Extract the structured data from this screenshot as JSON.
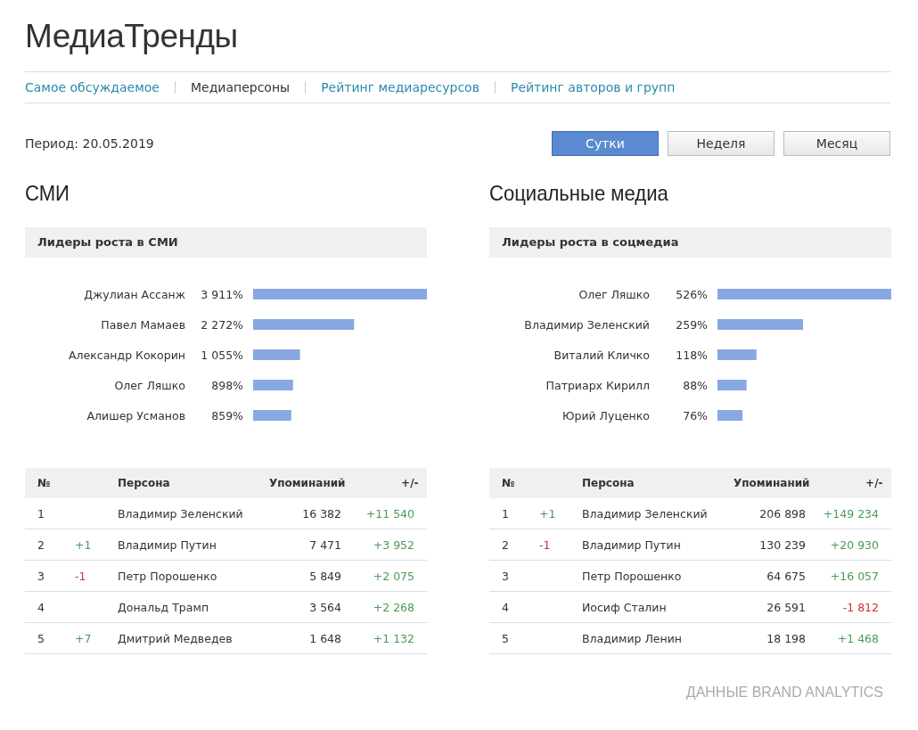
{
  "title": "МедиаТренды",
  "nav": [
    {
      "label": "Самое обсуждаемое",
      "selected": false
    },
    {
      "label": "Медиаперсоны",
      "selected": true
    },
    {
      "label": "Рейтинг медиаресурсов",
      "selected": false
    },
    {
      "label": "Рейтинг авторов и групп",
      "selected": false
    }
  ],
  "period": "Период: 20.05.2019",
  "period_buttons": [
    {
      "label": "Сутки",
      "selected": true
    },
    {
      "label": "Неделя",
      "selected": false
    },
    {
      "label": "Месяц",
      "selected": false
    }
  ],
  "sections": [
    {
      "heading": "СМИ",
      "leaders_title": "Лидеры роста в СМИ",
      "chart_data": {
        "type": "bar",
        "orientation": "horizontal",
        "categories": [
          "Джулиан Ассанж",
          "Павел Мамаев",
          "Александр Кокорин",
          "Олег Ляшко",
          "Алишер Усманов"
        ],
        "series": [
          {
            "color": "#87a8e0",
            "values": [
              3911,
              2272,
              1055,
              898,
              859
            ],
            "value_labels": [
              "3 911%",
              "2 272%",
              "1 055%",
              "898%",
              "859%"
            ]
          }
        ]
      },
      "table": {
        "columns": [
          "№",
          "Персона",
          "Упоминаний",
          "+/-"
        ],
        "rows": [
          {
            "rank": "1",
            "person": "Владимир Зеленский",
            "mentions": "16 382",
            "delta": {
              "text": "+11 540",
              "color": "#4a9a5a"
            }
          },
          {
            "rank": "2",
            "rank_change": {
              "text": "+1",
              "color": "#4a9a5a"
            },
            "person": "Владимир Путин",
            "mentions": "7 471",
            "delta": {
              "text": "+3 952",
              "color": "#4a9a5a"
            }
          },
          {
            "rank": "3",
            "rank_change": {
              "text": "-1",
              "color": "#d03030"
            },
            "person": "Петр Порошенко",
            "mentions": "5 849",
            "delta": {
              "text": "+2 075",
              "color": "#4a9a5a"
            }
          },
          {
            "rank": "4",
            "person": "Дональд Трамп",
            "mentions": "3 564",
            "delta": {
              "text": "+2 268",
              "color": "#4a9a5a"
            }
          },
          {
            "rank": "5",
            "rank_change": {
              "text": "+7",
              "color": "#4a9a5a"
            },
            "person": "Дмитрий Медведев",
            "mentions": "1 648",
            "delta": {
              "text": "+1 132",
              "color": "#4a9a5a"
            }
          }
        ]
      }
    },
    {
      "heading": "Социальные медиа",
      "leaders_title": "Лидеры роста в соцмедиа",
      "chart_data": {
        "type": "bar",
        "orientation": "horizontal",
        "categories": [
          "Олег Ляшко",
          "Владимир Зеленский",
          "Виталий Кличко",
          "Патриарх Кирилл",
          "Юрий Луценко"
        ],
        "series": [
          {
            "color": "#87a8e0",
            "values": [
              526,
              259,
              118,
              88,
              76
            ],
            "value_labels": [
              "526%",
              "259%",
              "118%",
              "88%",
              "76%"
            ]
          }
        ]
      },
      "table": {
        "columns": [
          "№",
          "Персона",
          "Упоминаний",
          "+/-"
        ],
        "rows": [
          {
            "rank": "1",
            "rank_change": {
              "text": "+1",
              "color": "#4a9a5a"
            },
            "person": "Владимир Зеленский",
            "mentions": "206 898",
            "delta": {
              "text": "+149 234",
              "color": "#4a9a5a"
            }
          },
          {
            "rank": "2",
            "rank_change": {
              "text": "-1",
              "color": "#d03030"
            },
            "person": "Владимир Путин",
            "mentions": "130 239",
            "delta": {
              "text": "+20 930",
              "color": "#4a9a5a"
            }
          },
          {
            "rank": "3",
            "person": "Петр Порошенко",
            "mentions": "64 675",
            "delta": {
              "text": "+16 057",
              "color": "#4a9a5a"
            }
          },
          {
            "rank": "4",
            "person": "Иосиф Сталин",
            "mentions": "26 591",
            "delta": {
              "text": "-1 812",
              "color": "#d03030"
            }
          },
          {
            "rank": "5",
            "person": "Владимир Ленин",
            "mentions": "18 198",
            "delta": {
              "text": "+1 468",
              "color": "#4a9a5a"
            }
          }
        ]
      }
    }
  ],
  "footer": "ДАННЫЕ BRAND ANALYTICS"
}
